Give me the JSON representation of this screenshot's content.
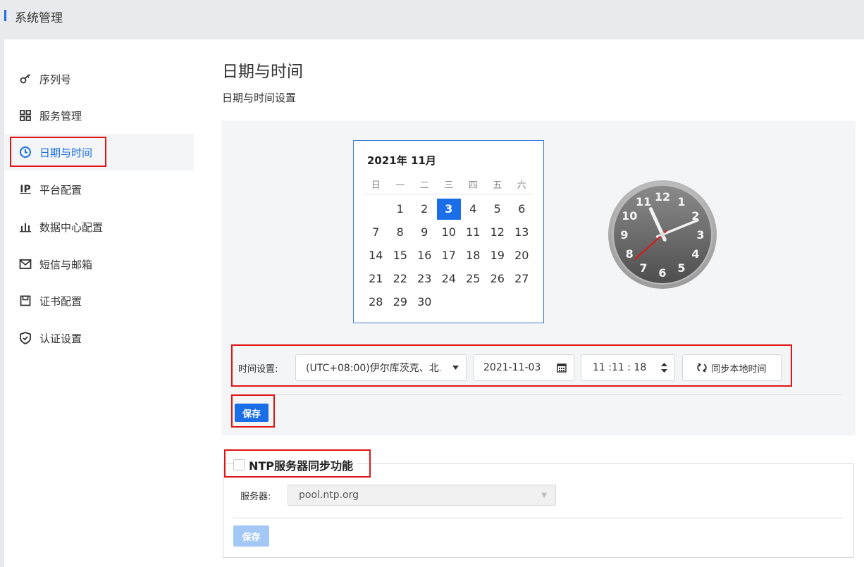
{
  "header": {
    "title": "系统管理"
  },
  "sidebar": {
    "items": [
      {
        "label": "序列号",
        "icon": "key-icon"
      },
      {
        "label": "服务管理",
        "icon": "grid-icon"
      },
      {
        "label": "日期与时间",
        "icon": "clock-icon",
        "active": true
      },
      {
        "label": "平台配置",
        "icon": "ip-icon"
      },
      {
        "label": "数据中心配置",
        "icon": "bar-chart-icon"
      },
      {
        "label": "短信与邮箱",
        "icon": "mail-icon"
      },
      {
        "label": "证书配置",
        "icon": "save-icon"
      },
      {
        "label": "认证设置",
        "icon": "shield-icon"
      }
    ]
  },
  "main": {
    "title": "日期与时间",
    "subtitle": "日期与时间设置",
    "calendar": {
      "title": "2021年  11月",
      "weekdays": [
        "日",
        "一",
        "二",
        "三",
        "四",
        "五",
        "六"
      ],
      "weeks": [
        [
          "",
          "1",
          "2",
          "3",
          "4",
          "5",
          "6"
        ],
        [
          "7",
          "8",
          "9",
          "10",
          "11",
          "12",
          "13"
        ],
        [
          "14",
          "15",
          "16",
          "17",
          "18",
          "19",
          "20"
        ],
        [
          "21",
          "22",
          "23",
          "24",
          "25",
          "26",
          "27"
        ],
        [
          "28",
          "29",
          "30",
          "",
          "",
          "",
          ""
        ]
      ],
      "selected": "3"
    },
    "clock": {
      "numbers": [
        "12",
        "1",
        "2",
        "3",
        "4",
        "5",
        "6",
        "7",
        "8",
        "9",
        "10",
        "11"
      ],
      "hour": 11,
      "minute": 11,
      "second": 18
    },
    "time_settings": {
      "label": "时间设置:",
      "timezone": "(UTC+08:00)伊尔库茨克、北...",
      "date": "2021-11-03",
      "time": "11 :11 : 18",
      "sync_button": "同步本地时间"
    },
    "save_button": "保存",
    "ntp": {
      "title": "NTP服务器同步功能",
      "enabled": false,
      "server_label": "服务器:",
      "server_value": "pool.ntp.org",
      "save_button": "保存"
    }
  },
  "colors": {
    "primary": "#1a6ee8",
    "highlight": "#e01414",
    "panel": "#f4f5f7"
  }
}
